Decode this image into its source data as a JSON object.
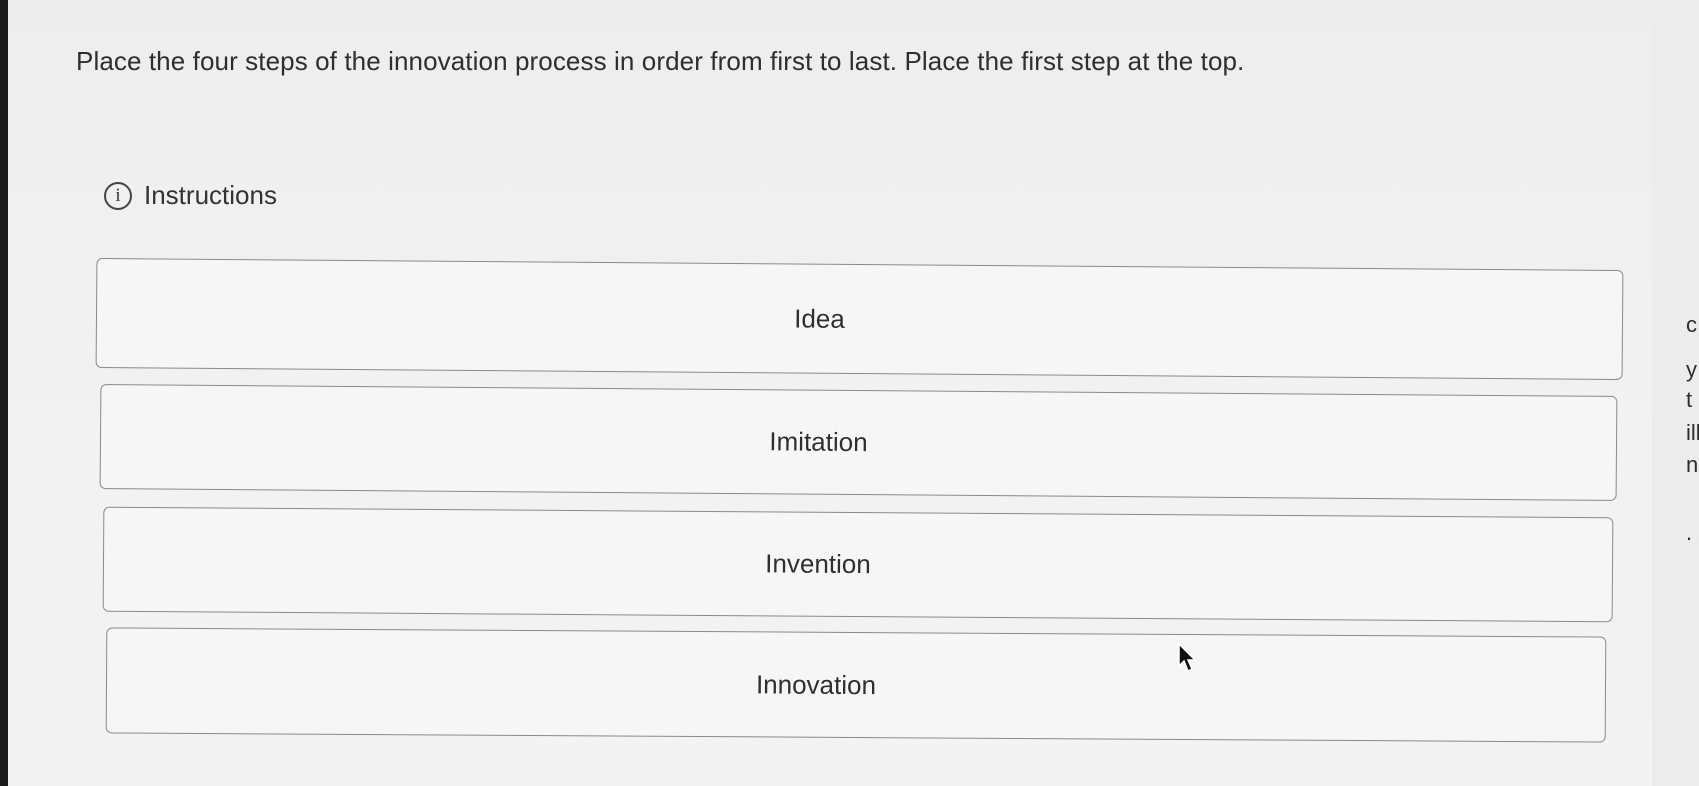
{
  "question": {
    "prompt": "Place the four steps of the innovation process in order from first to last. Place the first step at the top."
  },
  "instructions": {
    "icon": "info-icon",
    "label": "Instructions"
  },
  "sortable_items": [
    {
      "label": "Idea"
    },
    {
      "label": "Imitation"
    },
    {
      "label": "Invention"
    },
    {
      "label": "Innovation"
    }
  ],
  "right_edge_fragments": [
    "c",
    "y",
    "t",
    "ill",
    "ng",
    ". s"
  ],
  "colors": {
    "background": "#f1f1f1",
    "text": "#2e2e2e",
    "border": "#8a8a8a"
  }
}
